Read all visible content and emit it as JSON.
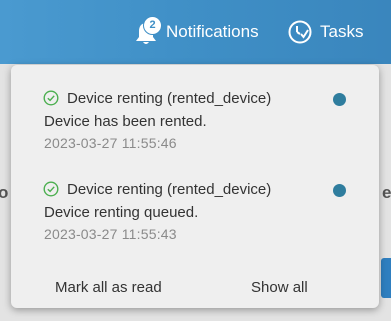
{
  "header": {
    "notifications_label": "Notifications",
    "notifications_badge": "2",
    "tasks_label": "Tasks"
  },
  "background": {
    "left_letter": "o",
    "right_letter": "e"
  },
  "notifications": {
    "items": [
      {
        "title": "Device renting (rented_device)",
        "message": "Device has been rented.",
        "timestamp": "2023-03-27 11:55:46",
        "status_icon": "check-circle-icon",
        "unread": true
      },
      {
        "title": "Device renting (rented_device)",
        "message": "Device renting queued.",
        "timestamp": "2023-03-27 11:55:43",
        "status_icon": "check-circle-icon",
        "unread": true
      }
    ],
    "mark_all_label": "Mark all as read",
    "show_all_label": "Show all"
  },
  "colors": {
    "header_bg": "#3f8fc6",
    "success_green": "#4caf50",
    "unread_dot": "#2f7d9e",
    "panel_bg": "#efefef"
  }
}
